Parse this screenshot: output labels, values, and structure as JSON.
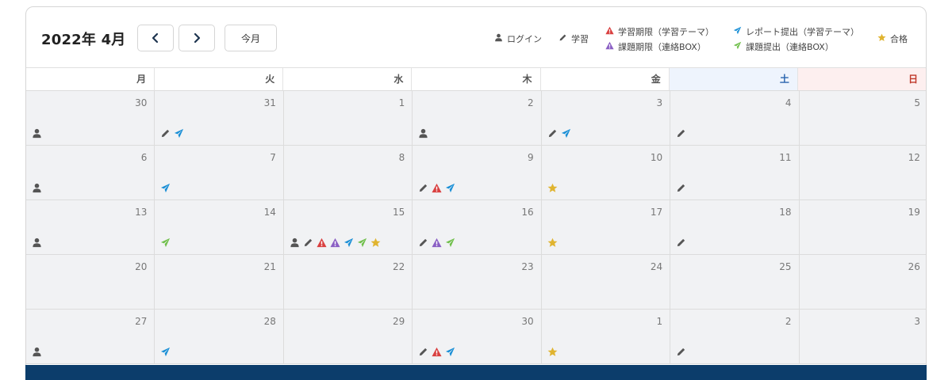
{
  "header": {
    "month_title": "2022年 4月",
    "today_label": "今月"
  },
  "legend": {
    "login": "ログイン",
    "study": "学習",
    "study_deadline": "学習期限（学習テーマ）",
    "task_deadline": "課題期限（連絡BOX）",
    "report_submit": "レポート提出（学習テーマ）",
    "task_submit": "課題提出（連絡BOX）",
    "pass": "合格"
  },
  "colors": {
    "login": "#555555",
    "study": "#555555",
    "study_deadline": "#d94040",
    "task_deadline": "#8a5fc4",
    "report_submit": "#1a8fd6",
    "task_submit": "#6fbf4a",
    "pass": "#e0b430",
    "footer": "#0c3d6b"
  },
  "weekdays": [
    "月",
    "火",
    "水",
    "木",
    "金",
    "土",
    "日"
  ],
  "weeks": [
    [
      {
        "day": "30",
        "icons": [
          "login"
        ]
      },
      {
        "day": "31",
        "icons": [
          "study",
          "report_submit"
        ]
      },
      {
        "day": "1",
        "icons": []
      },
      {
        "day": "2",
        "icons": [
          "login"
        ]
      },
      {
        "day": "3",
        "icons": [
          "study",
          "report_submit"
        ]
      },
      {
        "day": "4",
        "icons": [
          "study"
        ]
      },
      {
        "day": "5",
        "icons": []
      }
    ],
    [
      {
        "day": "6",
        "icons": [
          "login"
        ]
      },
      {
        "day": "7",
        "icons": [
          "report_submit"
        ]
      },
      {
        "day": "8",
        "icons": []
      },
      {
        "day": "9",
        "icons": [
          "study",
          "study_deadline",
          "report_submit"
        ]
      },
      {
        "day": "10",
        "icons": [
          "pass"
        ]
      },
      {
        "day": "11",
        "icons": [
          "study"
        ]
      },
      {
        "day": "12",
        "icons": []
      }
    ],
    [
      {
        "day": "13",
        "icons": [
          "login"
        ]
      },
      {
        "day": "14",
        "icons": [
          "task_submit"
        ]
      },
      {
        "day": "15",
        "icons": [
          "login",
          "study",
          "study_deadline",
          "task_deadline",
          "report_submit",
          "task_submit",
          "pass"
        ]
      },
      {
        "day": "16",
        "icons": [
          "study",
          "task_deadline",
          "task_submit"
        ]
      },
      {
        "day": "17",
        "icons": [
          "pass"
        ]
      },
      {
        "day": "18",
        "icons": [
          "study"
        ]
      },
      {
        "day": "19",
        "icons": []
      }
    ],
    [
      {
        "day": "20",
        "icons": []
      },
      {
        "day": "21",
        "icons": []
      },
      {
        "day": "22",
        "icons": []
      },
      {
        "day": "23",
        "icons": []
      },
      {
        "day": "24",
        "icons": []
      },
      {
        "day": "25",
        "icons": []
      },
      {
        "day": "26",
        "icons": []
      }
    ],
    [
      {
        "day": "27",
        "icons": [
          "login"
        ]
      },
      {
        "day": "28",
        "icons": [
          "report_submit"
        ]
      },
      {
        "day": "29",
        "icons": []
      },
      {
        "day": "30",
        "icons": [
          "study",
          "study_deadline",
          "report_submit"
        ]
      },
      {
        "day": "1",
        "icons": [
          "pass"
        ]
      },
      {
        "day": "2",
        "icons": [
          "study"
        ]
      },
      {
        "day": "3",
        "icons": []
      }
    ]
  ]
}
